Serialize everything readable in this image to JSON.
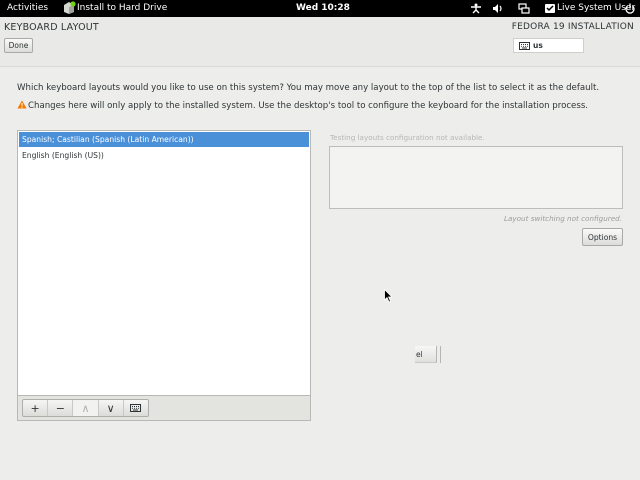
{
  "topbar": {
    "activities": "Activities",
    "app_menu": "Install to Hard Drive",
    "app_icon": "installer-icon",
    "clock": "Wed 10:28",
    "tray_icons": [
      "accessibility-icon",
      "volume-icon",
      "network-icon",
      "power-icon"
    ],
    "user_menu": "Live System User",
    "user_icon": "user-icon"
  },
  "header": {
    "title": "KEYBOARD LAYOUT",
    "done_label": "Done",
    "install_title": "FEDORA 19 INSTALLATION",
    "keyboard_indicator": "us",
    "keyboard_icon": "keyboard-icon"
  },
  "content": {
    "question": "Which keyboard layouts would you like to use on this system?  You may move any layout to the top of the list to select it as the default.",
    "warning": "Changes here will only apply to the installed system. Use the desktop's tool to configure the keyboard for the installation process.",
    "warning_icon": "warning-icon",
    "warning_color": "#f57900"
  },
  "layouts": {
    "items": [
      {
        "label": "Spanish; Castilian (Spanish (Latin American))",
        "selected": true
      },
      {
        "label": "English (English (US))",
        "selected": false
      }
    ],
    "toolbar": [
      {
        "name": "add-layout-button",
        "glyph": "+",
        "icon": "plus-icon"
      },
      {
        "name": "remove-layout-button",
        "glyph": "−",
        "icon": "minus-icon"
      },
      {
        "name": "move-up-button",
        "glyph": "∧",
        "icon": "chevron-up-icon",
        "disabled": true
      },
      {
        "name": "move-down-button",
        "glyph": "∨",
        "icon": "chevron-down-icon"
      },
      {
        "name": "preview-layout-button",
        "icon": "keyboard-icon"
      }
    ]
  },
  "testing": {
    "label": "Testing layouts configuration not available.",
    "switch_label": "Layout switching not configured.",
    "options_label": "Options"
  },
  "partial": {
    "label": "el"
  },
  "colors": {
    "selection": "#4a90d9",
    "topbar": "#000000",
    "background": "#ededeb"
  }
}
